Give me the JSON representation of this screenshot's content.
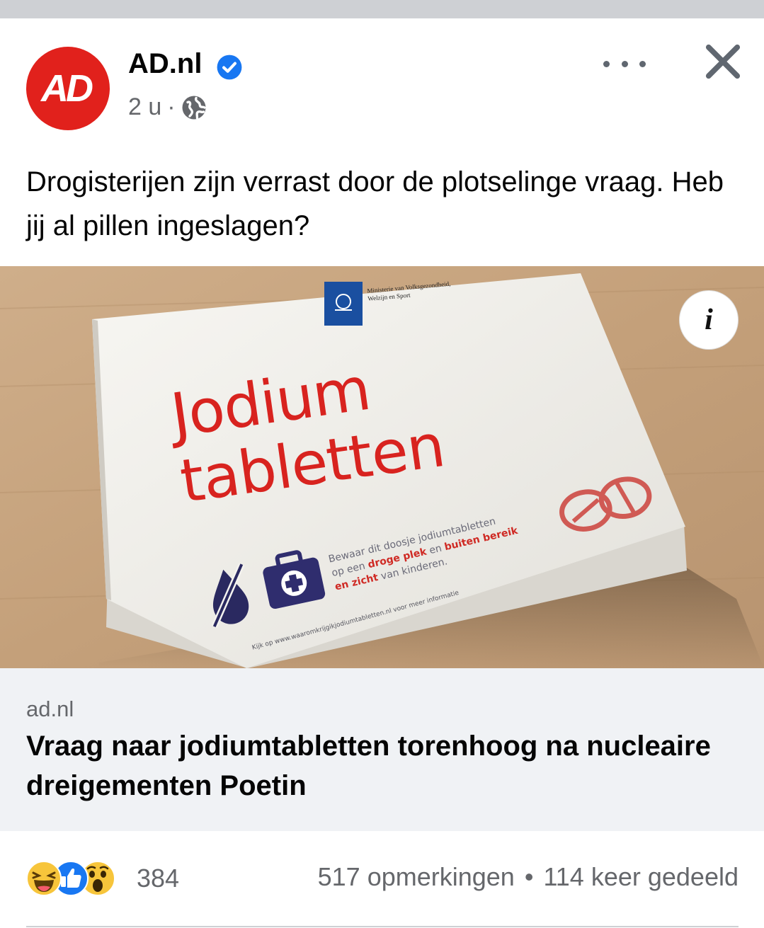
{
  "post": {
    "page_name": "AD.nl",
    "avatar_text": "AD",
    "time": "2 u",
    "meta_separator": "·",
    "caption": "Drogisterijen zijn verrast door de plotselinge vraag. Heb jij al pillen ingeslagen?"
  },
  "image": {
    "ministry_line1": "Ministerie van Volksgezondheid,",
    "ministry_line2": "Welzijn en Sport",
    "box_line1": "Jodium",
    "box_line2": "tabletten",
    "small_line1": "Bewaar dit doosje jodiumtabletten",
    "small_line2_a": "op een ",
    "small_line2_b": "droge plek",
    "small_line2_c": " en ",
    "small_line2_d": "buiten bereik",
    "small_line3_a": "en zicht",
    "small_line3_b": " van kinderen.",
    "side_text": "Kijk op www.waaromkrijgikjodiumtabletten.nl voor meer informatie",
    "info_label": "i"
  },
  "link": {
    "domain": "ad.nl",
    "title": "Vraag naar jodiumtabletten torenhoog na nucleaire dreigementen Poetin"
  },
  "engagement": {
    "reaction_count": "384",
    "comments": "517 opmerkingen",
    "separator": "•",
    "shares": "114 keer gedeeld",
    "reaction_icons": [
      "haha-icon",
      "like-icon",
      "wow-icon"
    ]
  },
  "colors": {
    "brand_red": "#e1211c",
    "facebook_blue": "#1877f2",
    "secondary_text": "#65676b"
  }
}
